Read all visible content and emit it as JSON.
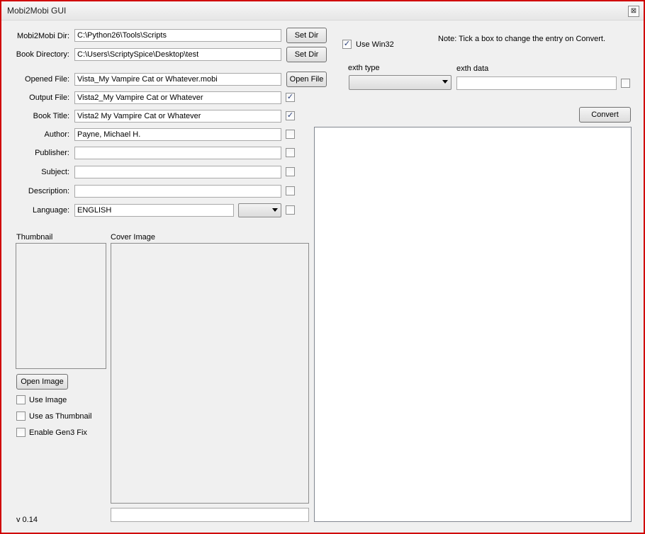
{
  "window": {
    "title": "Mobi2Mobi GUI",
    "close_glyph": "⊠"
  },
  "paths": {
    "mobi_dir_label": "Mobi2Mobi Dir:",
    "mobi_dir_value": "C:\\Python26\\Tools\\Scripts",
    "set_dir_1": "Set Dir",
    "book_dir_label": "Book Directory:",
    "book_dir_value": "C:\\Users\\ScriptySpice\\Desktop\\test",
    "set_dir_2": "Set Dir"
  },
  "fields": {
    "opened_file": {
      "label": "Opened File:",
      "value": "Vista_My Vampire Cat or Whatever.mobi",
      "button": "Open File"
    },
    "output_file": {
      "label": "Output File:",
      "value": "Vista2_My Vampire Cat or Whatever",
      "checked": "✓"
    },
    "book_title": {
      "label": "Book Title:",
      "value": "Vista2 My Vampire Cat or Whatever",
      "checked": "✓"
    },
    "author": {
      "label": "Author:",
      "value": "Payne, Michael H."
    },
    "publisher": {
      "label": "Publisher:",
      "value": ""
    },
    "subject": {
      "label": "Subject:",
      "value": ""
    },
    "description": {
      "label": "Description:",
      "value": ""
    },
    "language": {
      "label": "Language:",
      "value": "ENGLISH"
    }
  },
  "images": {
    "thumbnail_label": "Thumbnail",
    "cover_label": "Cover Image",
    "open_image": "Open Image",
    "use_image": "Use Image",
    "use_as_thumbnail": "Use as Thumbnail",
    "enable_gen3_fix": "Enable Gen3 Fix",
    "cover_path": ""
  },
  "options": {
    "use_win32": "Use Win32",
    "use_win32_checked": "✓",
    "note": "Note: Tick a box to change the entry on Convert.",
    "exth_type_label": "exth type",
    "exth_data_label": "exth data",
    "exth_data_value": "",
    "convert": "Convert"
  },
  "version": "v 0.14"
}
